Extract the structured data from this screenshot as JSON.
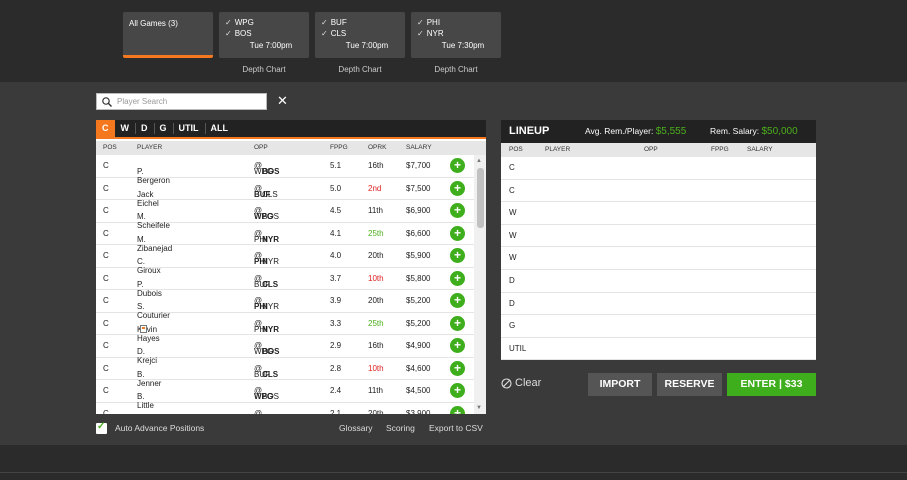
{
  "games": {
    "all": {
      "label": "All Games (3)"
    },
    "cards": [
      {
        "team1": "WPG",
        "team2": "BOS",
        "time": "Tue 7:00pm",
        "depth": "Depth Chart"
      },
      {
        "team1": "BUF",
        "team2": "CLS",
        "time": "Tue 7:00pm",
        "depth": "Depth Chart"
      },
      {
        "team1": "PHI",
        "team2": "NYR",
        "time": "Tue 7:30pm",
        "depth": "Depth Chart"
      }
    ]
  },
  "search": {
    "placeholder": "Player Search",
    "clear": "✕"
  },
  "tabs": [
    "C",
    "W",
    "D",
    "G",
    "UTIL",
    "ALL"
  ],
  "columns": {
    "pos": "POS",
    "player": "PLAYER",
    "opp": "OPP",
    "fppg": "FPPG",
    "oprk": "OPRK",
    "salary": "SALARY"
  },
  "players": [
    {
      "pos": "C",
      "name": "P. Bergeron",
      "away": "WPG",
      "home": "BOS",
      "own": "home",
      "fppg": "5.1",
      "oprk": "16th",
      "rk": "",
      "salary": "$7,700"
    },
    {
      "pos": "C",
      "name": "Jack Eichel",
      "away": "BUF",
      "home": "CLS",
      "own": "away",
      "fppg": "5.0",
      "oprk": "2nd",
      "rk": "bad",
      "salary": "$7,500"
    },
    {
      "pos": "C",
      "name": "M. Scheifele",
      "away": "WPG",
      "home": "BOS",
      "own": "away",
      "fppg": "4.5",
      "oprk": "11th",
      "rk": "",
      "salary": "$6,900"
    },
    {
      "pos": "C",
      "name": "M. Zibanejad",
      "away": "PHI",
      "home": "NYR",
      "own": "home",
      "fppg": "4.1",
      "oprk": "25th",
      "rk": "good",
      "salary": "$6,600"
    },
    {
      "pos": "C",
      "name": "C. Giroux",
      "away": "PHI",
      "home": "NYR",
      "own": "away",
      "fppg": "4.0",
      "oprk": "20th",
      "rk": "",
      "salary": "$5,900"
    },
    {
      "pos": "C",
      "name": "P. Dubois",
      "away": "BUF",
      "home": "CLS",
      "own": "home",
      "fppg": "3.7",
      "oprk": "10th",
      "rk": "bad",
      "salary": "$5,800"
    },
    {
      "pos": "C",
      "name": "S. Couturier",
      "away": "PHI",
      "home": "NYR",
      "own": "away",
      "fppg": "3.9",
      "oprk": "20th",
      "rk": "",
      "salary": "$5,200"
    },
    {
      "pos": "C",
      "name": "Kevin Hayes",
      "away": "PHI",
      "home": "NYR",
      "own": "home",
      "fppg": "3.3",
      "oprk": "25th",
      "rk": "good",
      "salary": "$5,200",
      "news": true
    },
    {
      "pos": "C",
      "name": "D. Krejci",
      "away": "WPG",
      "home": "BOS",
      "own": "home",
      "fppg": "2.9",
      "oprk": "16th",
      "rk": "",
      "salary": "$4,900"
    },
    {
      "pos": "C",
      "name": "B. Jenner",
      "away": "BUF",
      "home": "CLS",
      "own": "home",
      "fppg": "2.8",
      "oprk": "10th",
      "rk": "bad",
      "salary": "$4,600"
    },
    {
      "pos": "C",
      "name": "B. Little",
      "away": "WPG",
      "home": "BOS",
      "own": "away",
      "fppg": "2.4",
      "oprk": "11th",
      "rk": "",
      "salary": "$4,500"
    },
    {
      "pos": "C",
      "name": "N. Patrick",
      "away": "PHI",
      "home": "NYR",
      "own": "away",
      "fppg": "2.1",
      "oprk": "20th",
      "rk": "",
      "salary": "$3,900"
    }
  ],
  "options": {
    "auto_advance": "Auto Advance Positions",
    "glossary": "Glossary",
    "scoring": "Scoring",
    "export": "Export to CSV"
  },
  "lineup": {
    "title": "LINEUP",
    "avg_label": "Avg. Rem./Player:",
    "avg_value": "$5,555",
    "rem_label": "Rem. Salary:",
    "rem_value": "$50,000",
    "columns": {
      "pos": "POS",
      "player": "PLAYER",
      "opp": "OPP",
      "fppg": "FPPG",
      "salary": "SALARY"
    },
    "slots": [
      "C",
      "C",
      "W",
      "W",
      "W",
      "D",
      "D",
      "G",
      "UTIL"
    ]
  },
  "actions": {
    "clear": "Clear",
    "import": "IMPORT",
    "reserve": "RESERVE",
    "enter": "ENTER | $33"
  },
  "colors": {
    "accent": "#f5781e",
    "green": "#3fae1c",
    "bad": "#e02020"
  }
}
